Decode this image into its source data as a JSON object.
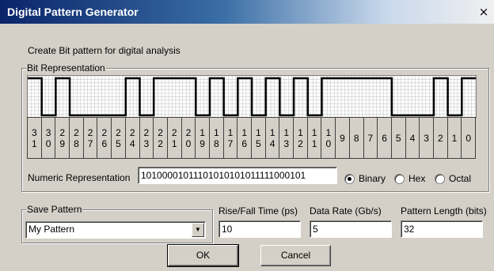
{
  "window": {
    "title": "Digital Pattern Generator",
    "close_glyph": "×"
  },
  "description": "Create Bit pattern for digital analysis",
  "bit_representation": {
    "title": "Bit Representation",
    "bits": [
      1,
      0,
      1,
      0,
      0,
      0,
      0,
      1,
      0,
      1,
      1,
      1,
      0,
      1,
      0,
      1,
      0,
      1,
      0,
      1,
      0,
      1,
      1,
      1,
      1,
      1,
      0,
      0,
      0,
      1,
      0,
      1
    ],
    "labels": [
      "31",
      "30",
      "29",
      "28",
      "27",
      "26",
      "25",
      "24",
      "23",
      "22",
      "21",
      "20",
      "19",
      "18",
      "17",
      "16",
      "15",
      "14",
      "13",
      "12",
      "11",
      "10",
      "9",
      "8",
      "7",
      "6",
      "5",
      "4",
      "3",
      "2",
      "1",
      "0"
    ]
  },
  "numeric": {
    "label": "Numeric Representation",
    "value": "10100001011101010101011111000101",
    "radios": [
      {
        "label": "Binary",
        "checked": true
      },
      {
        "label": "Hex",
        "checked": false
      },
      {
        "label": "Octal",
        "checked": false
      }
    ]
  },
  "save_pattern": {
    "title": "Save Pattern",
    "selected": "My Pattern"
  },
  "rise_fall": {
    "label": "Rise/Fall Time (ps)",
    "value": "10"
  },
  "data_rate": {
    "label": "Data Rate (Gb/s)",
    "value": "5"
  },
  "pattern_length": {
    "label": "Pattern Length (bits)",
    "value": "32"
  },
  "buttons": {
    "ok": "OK",
    "cancel": "Cancel"
  },
  "colors": {
    "title_start": "#0a246a",
    "face": "#d4d0c8"
  }
}
